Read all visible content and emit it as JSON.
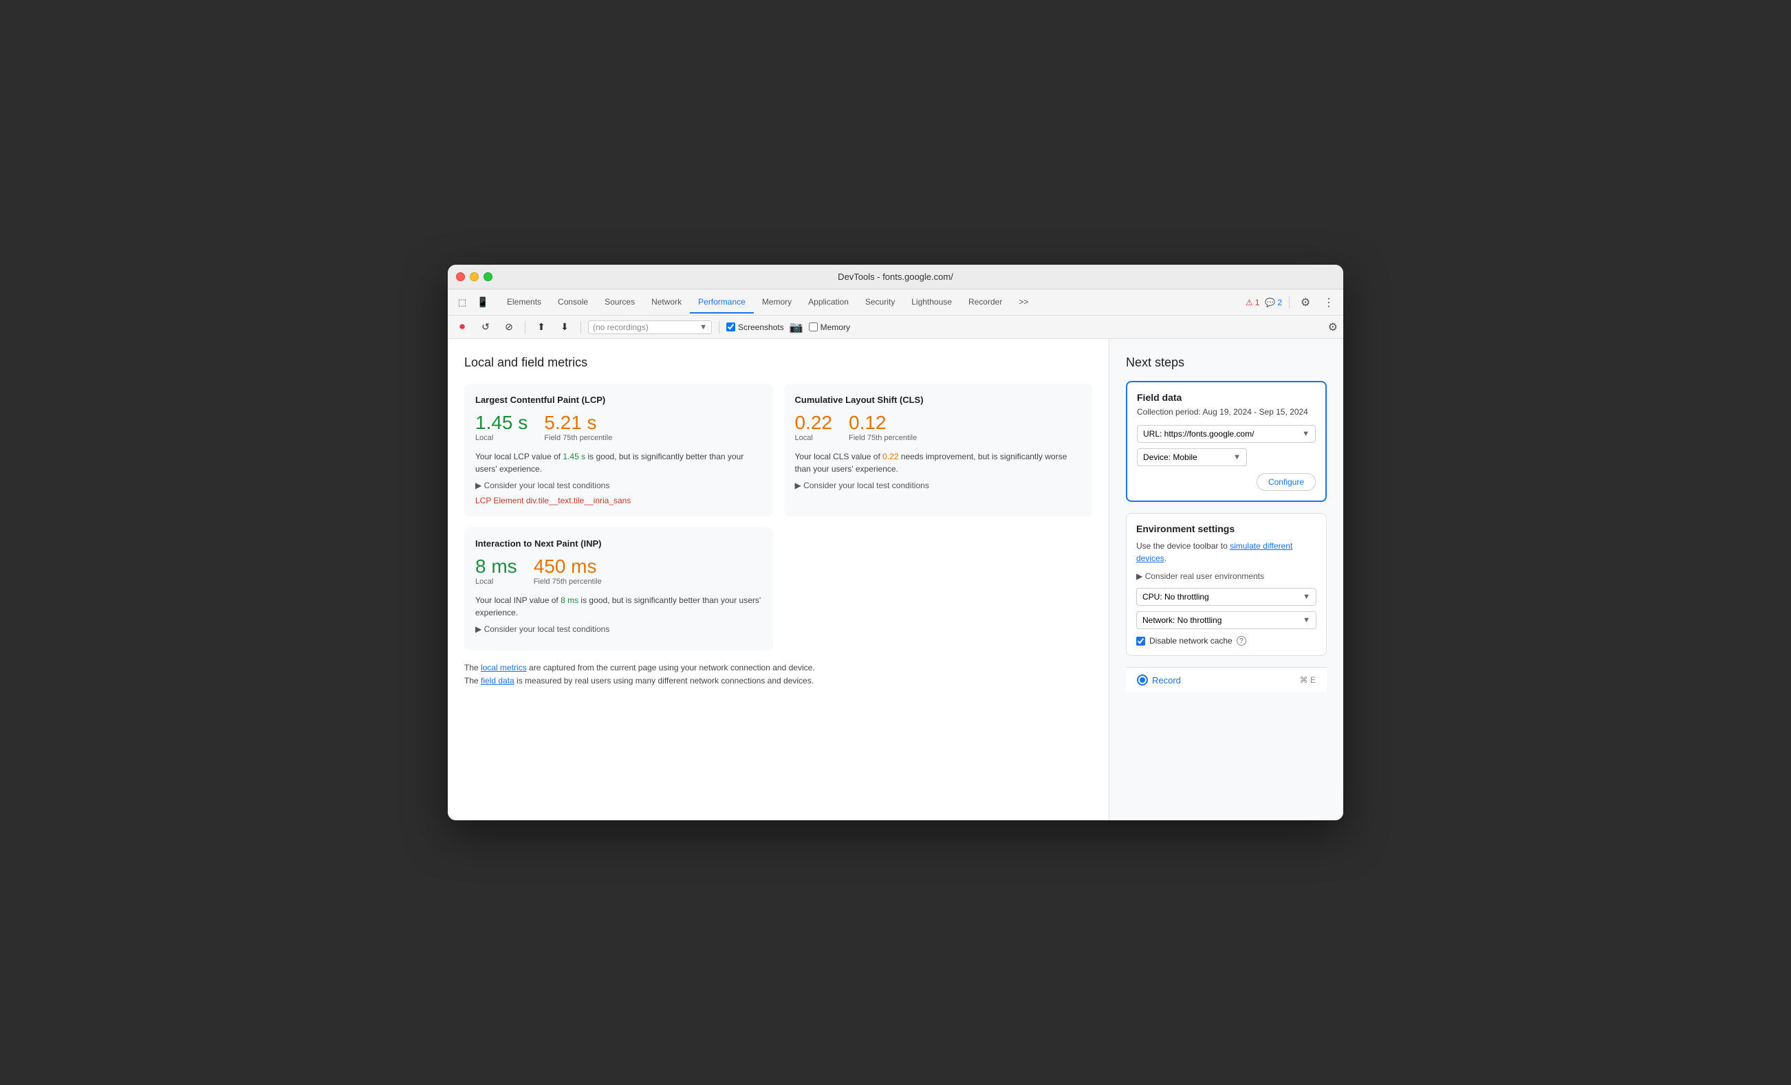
{
  "window": {
    "title": "DevTools - fonts.google.com/"
  },
  "tabs": [
    {
      "label": "Elements",
      "active": false
    },
    {
      "label": "Console",
      "active": false
    },
    {
      "label": "Sources",
      "active": false
    },
    {
      "label": "Network",
      "active": false
    },
    {
      "label": "Performance",
      "active": true
    },
    {
      "label": "Memory",
      "active": false
    },
    {
      "label": "Application",
      "active": false
    },
    {
      "label": "Security",
      "active": false
    },
    {
      "label": "Lighthouse",
      "active": false
    },
    {
      "label": "Recorder",
      "active": false
    }
  ],
  "toolbar_more": ">>",
  "warning_count": "1",
  "info_count": "2",
  "recording_placeholder": "(no recordings)",
  "screenshots_label": "Screenshots",
  "memory_label": "Memory",
  "main": {
    "section_title": "Local and field metrics",
    "lcp": {
      "title": "Largest Contentful Paint (LCP)",
      "local_value": "1.45 s",
      "field_value": "5.21 s",
      "local_label": "Local",
      "field_label": "Field 75th percentile",
      "description_prefix": "Your local LCP value of ",
      "description_local": "1.45 s",
      "description_mid": " is good, but is significantly better than your users' experience.",
      "consider_label": "▶ Consider your local test conditions",
      "lcp_element_prefix": "LCP Element ",
      "lcp_element_value": "div.tile__text.tile__inria_sans"
    },
    "cls": {
      "title": "Cumulative Layout Shift (CLS)",
      "local_value": "0.22",
      "field_value": "0.12",
      "local_label": "Local",
      "field_label": "Field 75th percentile",
      "description_prefix": "Your local CLS value of ",
      "description_local": "0.22",
      "description_mid": " needs improvement, but is significantly worse than your users' experience.",
      "consider_label": "▶ Consider your local test conditions"
    },
    "inp": {
      "title": "Interaction to Next Paint (INP)",
      "local_value": "8 ms",
      "field_value": "450 ms",
      "local_label": "Local",
      "field_label": "Field 75th percentile",
      "description_prefix": "Your local INP value of ",
      "description_local": "8 ms",
      "description_mid": " is good, but is significantly better than your users' experience.",
      "consider_label": "▶ Consider your local test conditions"
    },
    "footer": {
      "line1_prefix": "The ",
      "line1_link": "local metrics",
      "line1_suffix": " are captured from the current page using your network connection and device.",
      "line2_prefix": "The ",
      "line2_link": "field data",
      "line2_suffix": " is measured by real users using many different network connections and devices."
    }
  },
  "next_steps": {
    "title": "Next steps",
    "field_data": {
      "title": "Field data",
      "period": "Collection period: Aug 19, 2024 - Sep 15, 2024",
      "url_label": "URL: https://fonts.google.com/",
      "device_label": "Device: Mobile",
      "configure_label": "Configure"
    },
    "env_settings": {
      "title": "Environment settings",
      "description_prefix": "Use the device toolbar to ",
      "description_link": "simulate different devices",
      "description_suffix": ".",
      "consider_label": "▶ Consider real user environments",
      "cpu_label": "CPU: No throttling",
      "network_label": "Network: No throttling",
      "disable_cache_label": "Disable network cache"
    },
    "record": {
      "label": "Record",
      "shortcut": "⌘ E"
    }
  },
  "colors": {
    "good": "#1e8e3e",
    "needs_improvement": "#e37400",
    "accent": "#1a73e8",
    "danger": "#d93025"
  }
}
